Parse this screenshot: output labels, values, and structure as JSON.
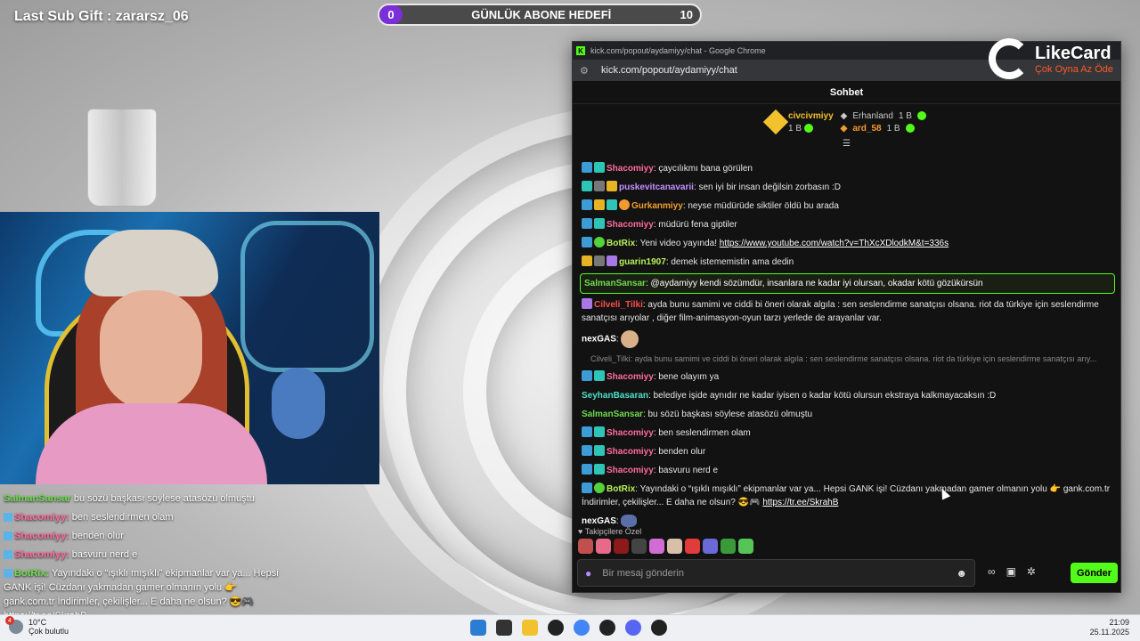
{
  "overlay": {
    "last_sub": "Last Sub Gift : zararsz_06",
    "goal": {
      "current": "0",
      "title": "GÜNLÜK ABONE HEDEFİ",
      "target": "10"
    }
  },
  "overlay_chat": [
    {
      "user": "SalmanSansar",
      "text": " bu sözü başkası söylese atasözü olmuştu"
    },
    {
      "user": "Shacomiyy:",
      "text": " ben seslendirmen olam"
    },
    {
      "user": "Shacomiyy:",
      "text": " benden olur"
    },
    {
      "user": "Shacomiyy:",
      "text": " basvuru nerd e"
    },
    {
      "user": "BotRix:",
      "text": " Yayındaki o “ışıklı mışıklı” ekipmanlar var ya... Hepsi GANK işi! Cüzdanı yakmadan gamer olmanın yolu 👉 gank.com.tr İndirimler, çekilişler... E daha ne olsun? 😎🎮 https://tr.ee/SkrahB"
    }
  ],
  "window": {
    "title": "kick.com/popout/aydamiyy/chat - Google Chrome",
    "url": "kick.com/popout/aydamiyy/chat",
    "ad_brand": "LikeCard",
    "ad_tagline": "Çok Oyna  Az Öde"
  },
  "chat": {
    "header": "Sohbet",
    "gifters": {
      "top": {
        "name": "civcivmiyy",
        "count": "1 B"
      },
      "others": [
        {
          "name": "Erhanland",
          "count": "1 B"
        },
        {
          "name": "ard_58",
          "count": "1 B"
        }
      ]
    },
    "messages": [
      {
        "user": "Shacomiyy",
        "text": ": çaycılıkmı bana görülen"
      },
      {
        "user": "puskevitcanavarii",
        "text": ": sen iyi bir insan değilsin zorbasın :D"
      },
      {
        "user": "Gurkanmiyy",
        "text": ": neyse müdürüde siktiler öldü bu arada"
      },
      {
        "user": "Shacomiyy",
        "text": ": müdürü fena giptiler"
      },
      {
        "user": "BotRix",
        "text": ": Yeni video yayında! ",
        "link": "https://www.youtube.com/watch?v=ThXcXDlodkM&t=336s"
      },
      {
        "user": "guarin1907",
        "text": ": demek istememistin ama dedin"
      },
      {
        "user": "SalmanSansar",
        "text": ": @aydamiyy kendi sözümdür, insanlara ne kadar iyi olursan, okadar kötü gözükürsün"
      },
      {
        "user": "Cilveli_Tilki",
        "text": ": ayda bunu samimi ve ciddi bi öneri olarak algıla : sen seslendirme sanatçısı olsana. riot da türkiye için seslendirme sanatçısı arıyolar , diğer film-animasyon-oyun tarzı yerlede de arayanlar var."
      },
      {
        "user": "nexGAS",
        "text": ":"
      },
      {
        "reply": "Cilveli_Tilki: ayda bunu samimi ve ciddi bi öneri olarak algıla : sen seslendirme sanatçısı olsana. riot da türkiye için seslendirme sanatçısı arıy..."
      },
      {
        "user": "Shacomiyy",
        "text": ": bene olayım ya"
      },
      {
        "user": "SeyhanBasaran",
        "text": ": belediye işide aynıdır ne kadar iyisen o kadar kötü olursun ekstraya kalkmayacaksın :D"
      },
      {
        "user": "SalmanSansar",
        "text": ": bu sözü başkası söylese atasözü olmuştu"
      },
      {
        "user": "Shacomiyy",
        "text": ": ben seslendirmen olam"
      },
      {
        "user": "Shacomiyy",
        "text": ": benden olur"
      },
      {
        "user": "Shacomiyy",
        "text": ": basvuru nerd e"
      },
      {
        "user": "BotRix",
        "text": ": Yayındaki o “ışıklı mışıklı” ekipmanlar var ya... Hepsi GANK işi! Cüzdanı yakmadan gamer olmanın yolu 👉 gank.com.tr İndirimler, çekilişler... E daha ne olsun? 😎🎮 ",
        "link": "https://tr.ee/SkrahB"
      },
      {
        "user": "nexGAS",
        "text": ":"
      }
    ],
    "followers_label": "Takipçilere Özel",
    "input_placeholder": "Bir mesaj gönderin",
    "send_label": "Gönder"
  },
  "taskbar": {
    "weather_alert": "4",
    "temp": "10°C",
    "condition": "Çok bulutlu",
    "time": "21:09",
    "date": "25.11.2025"
  },
  "colors": {
    "kick_green": "#53fc18",
    "goal_purple": "#7b2fd8",
    "gifter_gold": "#f2c12e",
    "username_pink": "#ff6b9e"
  }
}
